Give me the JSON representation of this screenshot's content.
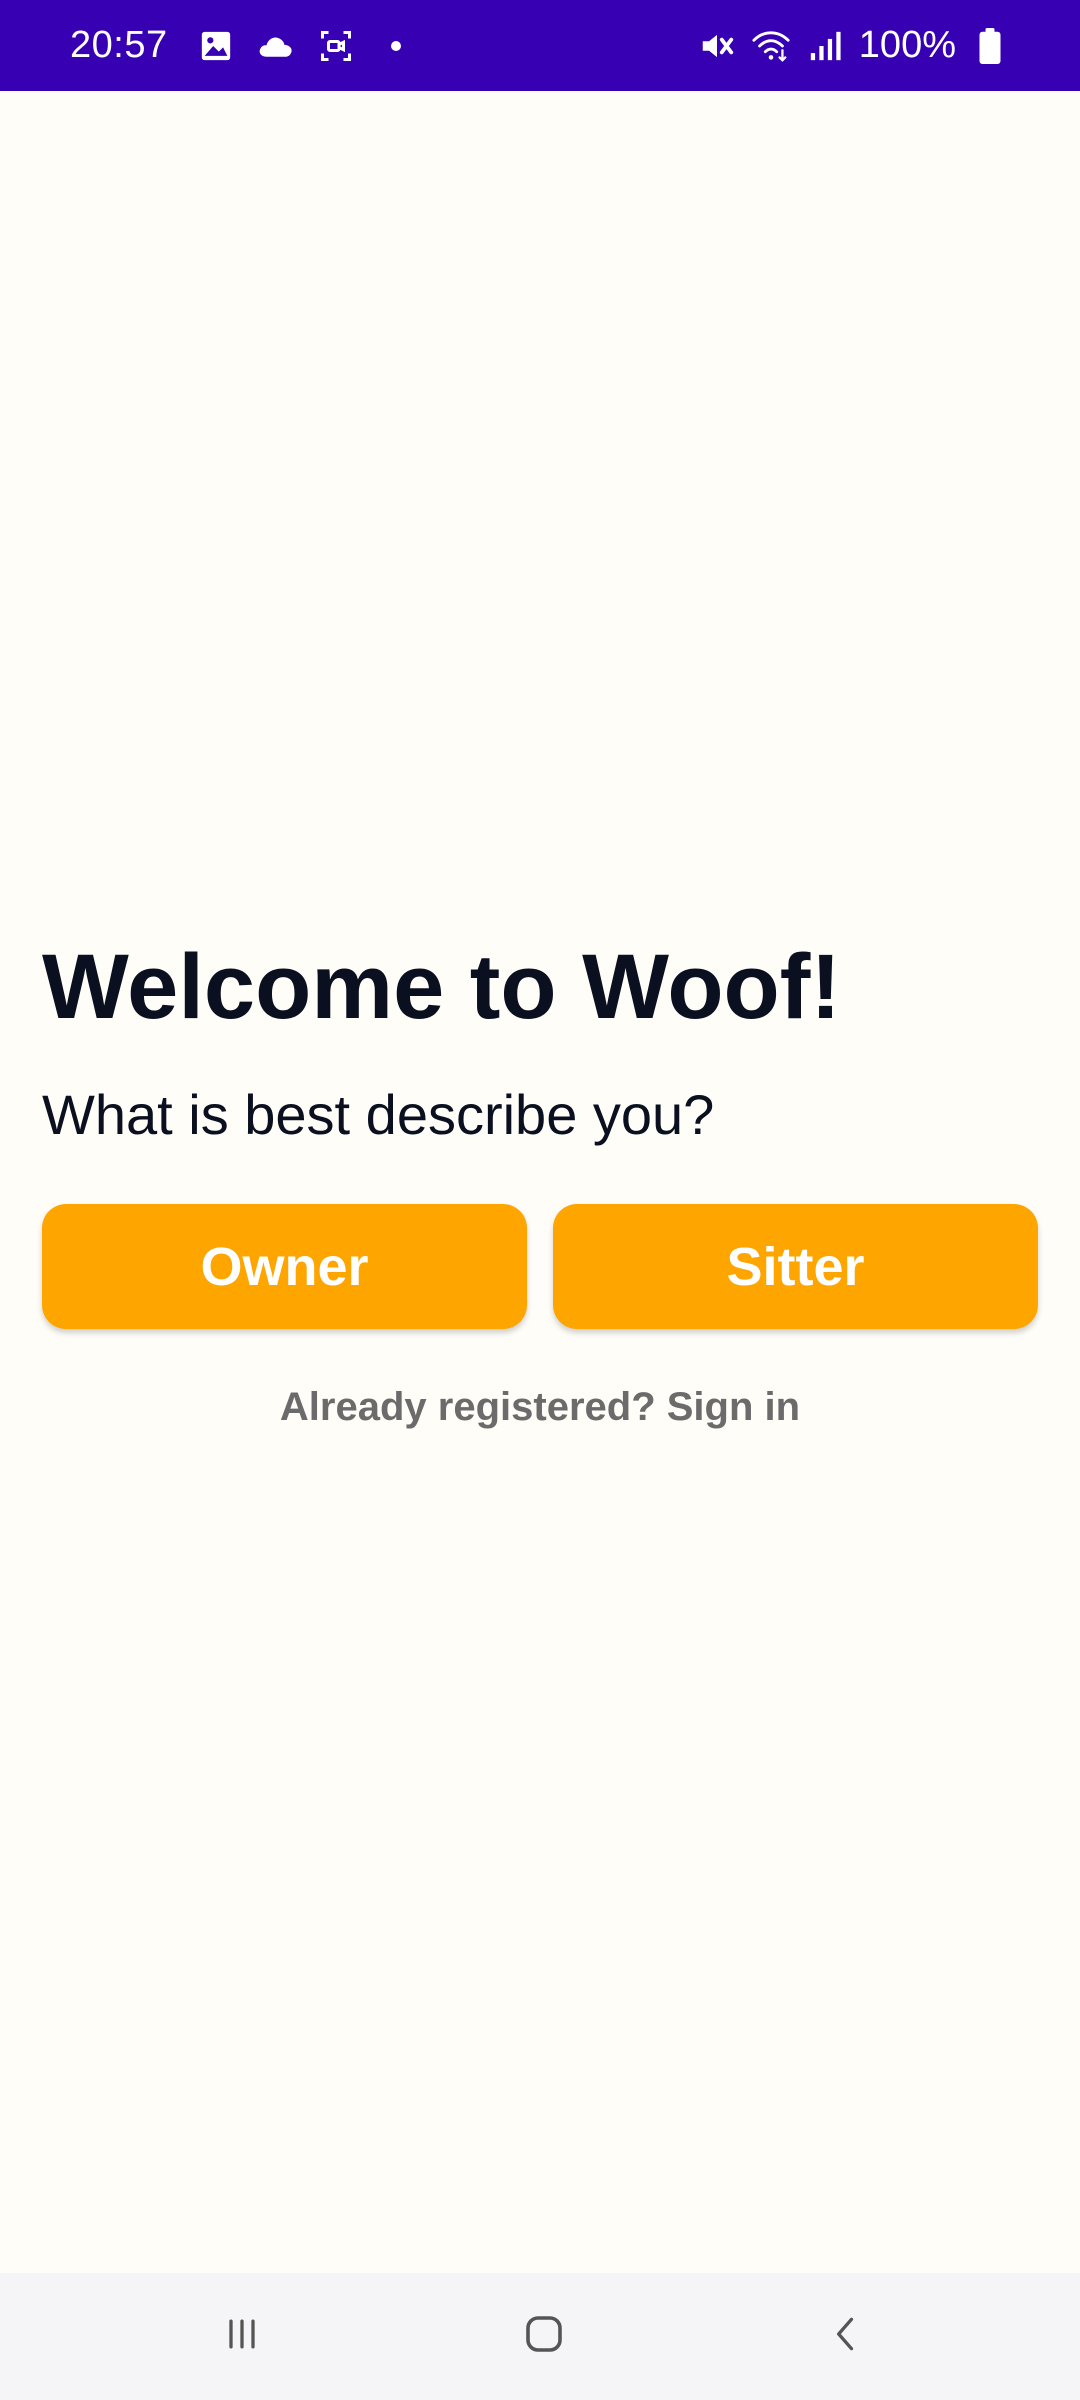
{
  "status_bar": {
    "time": "20:57",
    "battery_percent": "100%",
    "left_icons": [
      "image-icon",
      "cloud-icon",
      "screen-record-icon",
      "dot-icon"
    ],
    "right_icons": [
      "mute-icon",
      "wifi-icon",
      "signal-icon",
      "battery-icon"
    ],
    "background_color": "#3700B3"
  },
  "welcome": {
    "title": "Welcome to Woof!",
    "subtitle": "What is best describe you?"
  },
  "roles": {
    "owner_label": "Owner",
    "sitter_label": "Sitter",
    "button_color": "#FFA500"
  },
  "signin": {
    "label": "Already registered? Sign in"
  },
  "nav_bar": {
    "icons": [
      "recents-icon",
      "home-icon",
      "back-icon"
    ]
  },
  "colors": {
    "background": "#FFFDF8",
    "text": "#0B1020",
    "link": "#6B6B6B"
  }
}
